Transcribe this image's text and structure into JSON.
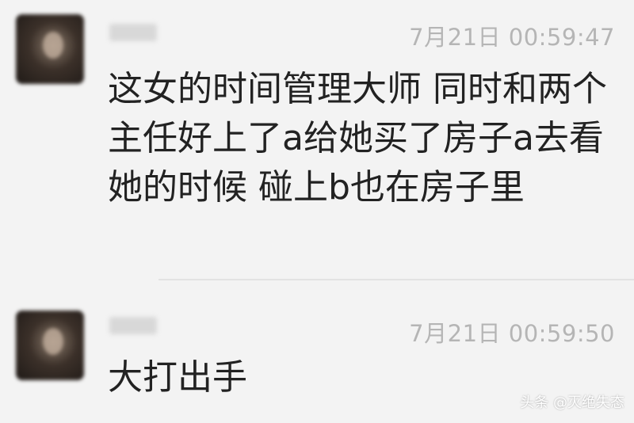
{
  "messages": [
    {
      "username": "",
      "timestamp": "7月21日 00:59:47",
      "text": "这女的时间管理大师 同时和两个主任好上了a给她买了房子a去看她的时候 碰上b也在房子里"
    },
    {
      "username": "",
      "timestamp": "7月21日 00:59:50",
      "text": "大打出手"
    }
  ],
  "watermark": "头条 @灭绝失态",
  "colors": {
    "background": "#f3f3f3",
    "text": "#222222",
    "timestamp": "#b5b5b5"
  }
}
